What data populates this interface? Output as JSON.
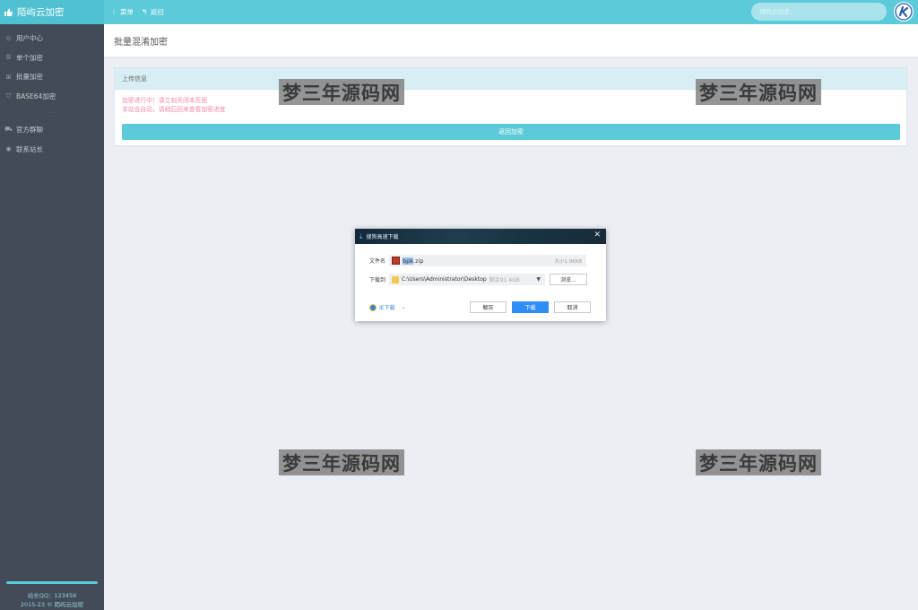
{
  "topbar": {
    "brand": "陌屿云加密",
    "menu_label": "菜单",
    "back_label": "返回",
    "search_placeholder": "陌屿云加密..."
  },
  "sidebar": {
    "items": [
      {
        "label": "用户中心",
        "icon": "gauge-icon"
      },
      {
        "label": "单个加密",
        "icon": "list-icon"
      },
      {
        "label": "批量加密",
        "icon": "plus-square-icon"
      },
      {
        "label": "BASE64加密",
        "icon": "shield-icon"
      }
    ],
    "separator": "···",
    "items2": [
      {
        "label": "官方群聊",
        "icon": "cart-icon"
      },
      {
        "label": "联系站长",
        "icon": "chat-icon"
      }
    ],
    "footer_qq": "站长QQ：123456",
    "footer_copy": "2015-23 © 陌屿云加密"
  },
  "page": {
    "title": "批量混淆加密",
    "panel_title": "上传信息",
    "message_line1": "加密进行中！请立刻关闭本页面",
    "message_line2": "本站会自动，请稍后回来查看加密进度",
    "back_button": "返回加密"
  },
  "watermark": "梦三年源码网",
  "dialog": {
    "title": "搜狗高速下载",
    "filename_label": "文件名",
    "filename_highlight": "bpk",
    "filename_rest": ".zip",
    "file_size": "大小1.06KB",
    "saveto_label": "下载到",
    "path": "C:\\Users\\Administrator\\Desktop",
    "free_space": "剩余91.4GB",
    "browse_button": "浏览...",
    "ie_label": "IE下载",
    "unzip_button": "解压",
    "download_button": "下载",
    "cancel_button": "取消"
  },
  "colors": {
    "accent": "#5bcad9",
    "sidebar": "#424b57",
    "primary_button": "#2f8ef5",
    "message": "#f08aa8"
  }
}
